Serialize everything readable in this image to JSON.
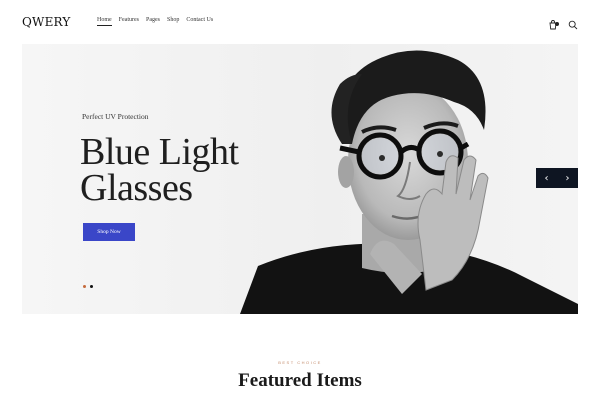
{
  "brand": {
    "logo": "QWERY"
  },
  "nav": {
    "items": [
      {
        "label": "Home",
        "active": true
      },
      {
        "label": "Features",
        "active": false
      },
      {
        "label": "Pages",
        "active": false
      },
      {
        "label": "Shop",
        "active": false
      },
      {
        "label": "Contact Us",
        "active": false
      }
    ]
  },
  "header_icons": [
    "cart-icon",
    "search-icon"
  ],
  "hero": {
    "eyebrow": "Perfect UV Protection",
    "headline_line1": "Blue Light",
    "headline_line2": "Glasses",
    "button_label": "Shop Now",
    "slide_count": 2,
    "active_slide": 2,
    "prev_arrow": "‹",
    "next_arrow": "›"
  },
  "featured": {
    "kicker": "BEST CHOICE",
    "title": "Featured Items"
  },
  "colors": {
    "accent_button": "#3a46c8",
    "slider_nav_bg": "#0e1522",
    "kicker": "#c38a6a"
  }
}
